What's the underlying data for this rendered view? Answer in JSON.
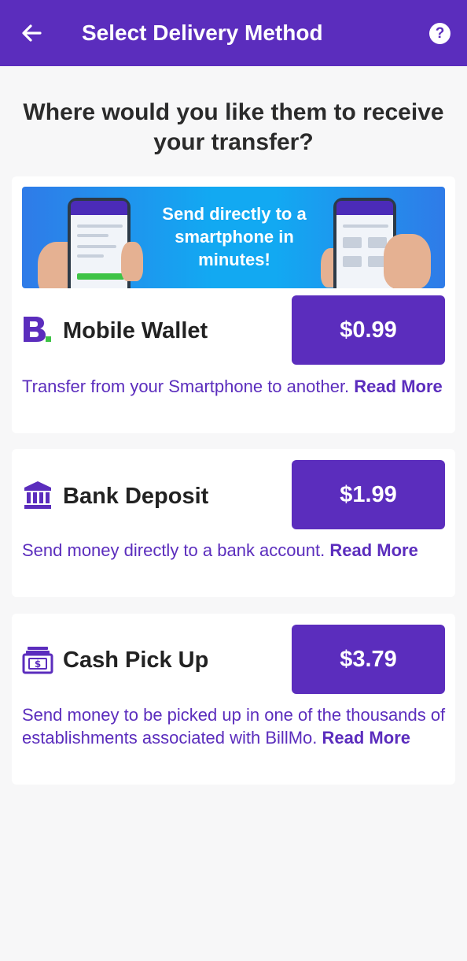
{
  "app_bar": {
    "title": "Select Delivery Method",
    "back_icon": "arrow-left-icon",
    "help_icon": "help-circle-icon",
    "help_glyph": "?"
  },
  "question": "Where would you like them to receive your transfer?",
  "colors": {
    "primary": "#5b2dbd",
    "background": "#f7f7f8",
    "banner": "#12a9f2",
    "brand_dot": "#3ec346"
  },
  "banner": {
    "text": "Send directly to a smartphone in minutes!"
  },
  "methods": [
    {
      "name": "Mobile Wallet",
      "icon": "billmo-logo-icon",
      "price": "$0.99",
      "description": "Transfer from your Smartphone to another.",
      "read_more": "Read More"
    },
    {
      "name": "Bank Deposit",
      "icon": "bank-icon",
      "price": "$1.99",
      "description": "Send money directly to a bank account.",
      "read_more": "Read More"
    },
    {
      "name": "Cash Pick Up",
      "icon": "cash-icon",
      "price": "$3.79",
      "description": "Send money to be picked up in one of the thousands of establishments associated with BillMo.",
      "read_more": "Read More"
    }
  ]
}
